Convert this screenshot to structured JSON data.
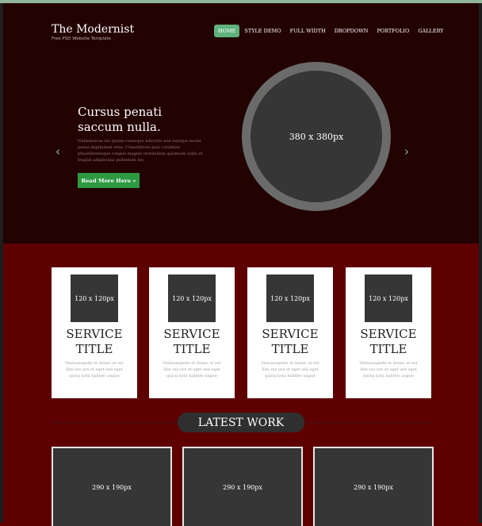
{
  "site": {
    "brand": "The Modernist",
    "tagline": "Free PSD Website Template"
  },
  "nav": [
    {
      "label": "Home",
      "active": true
    },
    {
      "label": "Style Demo",
      "active": false
    },
    {
      "label": "Full Width",
      "active": false
    },
    {
      "label": "Dropdown",
      "active": false
    },
    {
      "label": "Portfolio",
      "active": false
    },
    {
      "label": "Gallery",
      "active": false
    }
  ],
  "hero": {
    "heading": "Cursus penati saccum nulla.",
    "text": "Nullamlacus dui ipsum conseque loborttis non euisque morbi penas dapibulum orna. Urnaultrices quis curabitur phasellentesque congue magnis vestibulum quismodo nulla et feugiat adipiscinia pellentum leo.",
    "button_label": "Read More Here »",
    "image_label": "380 x 380px",
    "left_arrow": "‹",
    "right_arrow": "›"
  },
  "services": [
    {
      "image_label": "120 x 120px",
      "title": "SERVICE TITLE",
      "desc": "Vestassapede et donec at est libe ras ure et eget sed eget quisq nota habiter augue"
    },
    {
      "image_label": "120 x 120px",
      "title": "SERVICE TITLE",
      "desc": "Vestassapede et donec at est libe ras ure et eget sed eget quisq nota habiter augue"
    },
    {
      "image_label": "120 x 120px",
      "title": "SERVICE TITLE",
      "desc": "Vestassapede et donec at est libe ras ure et eget sed eget quisq nota habiter augue"
    },
    {
      "image_label": "120 x 120px",
      "title": "SERVICE TITLE",
      "desc": "Vestassapede et donec at est libe ras ure et eget sed eget quisq nota habiter augue"
    }
  ],
  "latest_work": {
    "heading": "LATEST WORK",
    "items": [
      {
        "label": "290 x 190px"
      },
      {
        "label": "290 x 190px"
      },
      {
        "label": "290 x 190px"
      }
    ]
  },
  "colors": {
    "accent_green": "#5fb27c",
    "button_green": "#2d9a41",
    "header_bg": "#230202",
    "body_bg": "#5e0000"
  }
}
